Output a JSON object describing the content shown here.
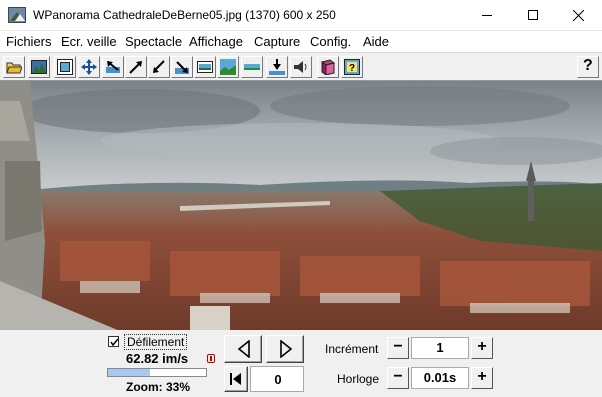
{
  "titlebar": {
    "title": "WPanorama  CathedraleDeBerne05.jpg       (1370) 600 x 250",
    "icon": "wpanorama-app-icon"
  },
  "menu": [
    "Fichiers",
    "Ecr. veille",
    "Spectacle",
    "Affichage",
    "Capture",
    "Config.",
    "Aide"
  ],
  "toolbar": {
    "icons": [
      "open-folder-icon",
      "picture-icon",
      "frame-icon",
      "fit-arrows-icon",
      "arrow-up-left-icon",
      "arrow-diag-up-icon",
      "arrow-diag-down-icon",
      "arrow-down-right-icon",
      "panorama-strip-icon",
      "panorama-sky-icon",
      "panorama-flat-icon",
      "zoom-mountain-icon",
      "speaker-icon",
      "book-icon",
      "help-frame-icon"
    ],
    "help_label": "?"
  },
  "panorama": {
    "sky_color": "#9aa1a6",
    "roof_color": "#9a5a3e"
  },
  "controls": {
    "scroll_label": "Défilement",
    "scroll_checked": true,
    "speed": "62.82 im/s",
    "zoom_label": "Zoom: 33%",
    "zoom_fraction": 0.43,
    "counter": "0",
    "increment_label": "Incrément",
    "increment_value": "1",
    "clock_label": "Horloge",
    "clock_value": "0.01s",
    "minus": "−",
    "plus": "+"
  }
}
